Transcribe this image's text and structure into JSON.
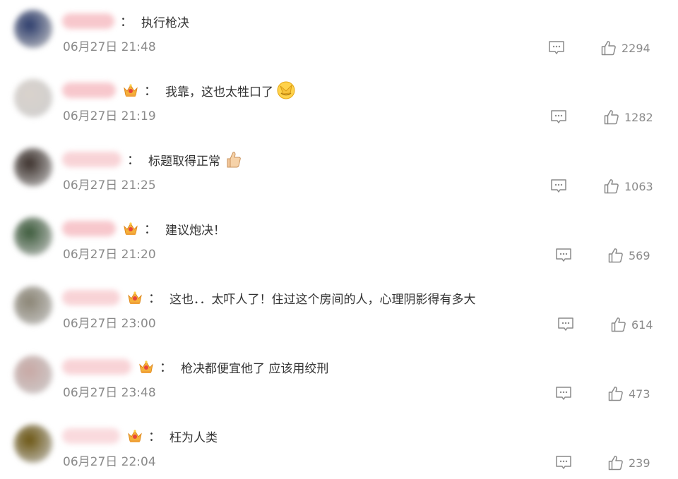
{
  "comments": [
    {
      "username": "",
      "crown": false,
      "text": "执行枪决",
      "emoji": "",
      "time": "06月27日 21:48",
      "likes": "2294",
      "avatar_color": "#2a3a6a",
      "name_color": "#f19aa3",
      "name_width": 74
    },
    {
      "username": "",
      "crown": true,
      "text": "我靠，这也太牲口了",
      "emoji": "facepalm-emoji",
      "time": "06月27日 21:19",
      "likes": "1282",
      "avatar_color": "#d9d2cc",
      "name_color": "#f19aa3",
      "name_width": 76
    },
    {
      "username": "",
      "crown": false,
      "text": "标题取得正常",
      "emoji": "thumbs-up-emoji",
      "time": "06月27日 21:25",
      "likes": "1063",
      "avatar_color": "#3a2f2a",
      "name_color": "#f3b0b6",
      "name_width": 84
    },
    {
      "username": "",
      "crown": true,
      "text": "建议炮决！",
      "emoji": "",
      "time": "06月27日 21:20",
      "likes": "569",
      "avatar_color": "#3b5a3a",
      "name_color": "#f19aa3",
      "name_width": 76
    },
    {
      "username": "",
      "crown": true,
      "text": "这也．．太吓人了！住过这个房间的人，心理阴影得有多大",
      "emoji": "",
      "time": "06月27日 23:00",
      "likes": "614",
      "avatar_color": "#8a8474",
      "name_color": "#f3b0b6",
      "name_width": 82
    },
    {
      "username": "",
      "crown": true,
      "text": "枪决都便宜他了 应该用绞刑",
      "emoji": "",
      "time": "06月27日 23:48",
      "likes": "473",
      "avatar_color": "#c8a8a4",
      "name_color": "#f3b0b6",
      "name_width": 98
    },
    {
      "username": "",
      "crown": true,
      "text": "枉为人类",
      "emoji": "",
      "time": "06月27日 22:04",
      "likes": "239",
      "avatar_color": "#6a5410",
      "name_color": "#f5bcc2",
      "name_width": 82
    }
  ],
  "icons": {
    "reply": "comment-reply-icon",
    "like": "thumbs-up-like-icon",
    "crown": "member-crown-icon"
  },
  "colors": {
    "text": "#333333",
    "meta": "#8a8a8a",
    "icon": "#8a8a8a",
    "username_blur": "#f19aa3"
  }
}
